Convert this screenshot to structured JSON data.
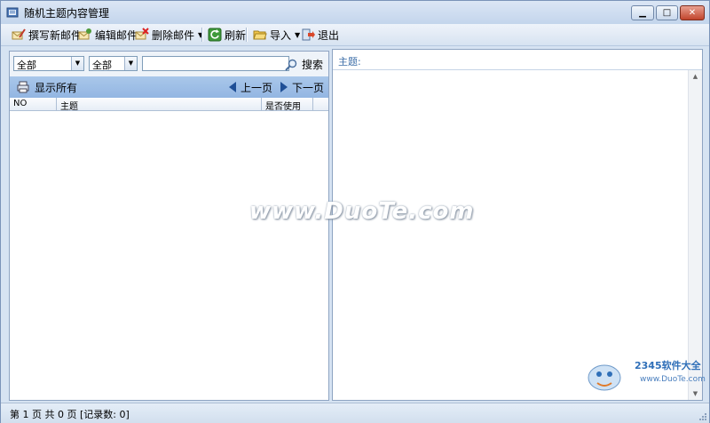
{
  "window": {
    "title": "随机主题内容管理",
    "controls": {
      "minimize": "minimize",
      "maximize": "maximize",
      "close": "close"
    }
  },
  "toolbar": {
    "compose_label": "撰写新邮件",
    "edit_label": "编辑邮件",
    "delete_label": "删除邮件",
    "refresh_label": "刷新",
    "import_label": "导入",
    "exit_label": "退出"
  },
  "filters": {
    "combo1_value": "全部",
    "combo2_value": "全部",
    "search_value": "",
    "search_label": "搜索"
  },
  "navbar": {
    "show_all_label": "显示所有",
    "prev_label": "上一页",
    "next_label": "下一页"
  },
  "list": {
    "columns": [
      "NO",
      "主题",
      "是否使用"
    ],
    "rows": []
  },
  "detail": {
    "subject_label": "主题:"
  },
  "status": {
    "text": "第 1 页 共 0 页  [记录数: 0]"
  },
  "watermark": {
    "text": "www.DuoTe.com"
  },
  "logo": {
    "brand": "2345软件大全",
    "url": "www.DuoTe.com"
  },
  "colors": {
    "accent": "#93b6e2",
    "window_bg": "#d6e3f2",
    "subject_label": "#3c6ea8"
  }
}
